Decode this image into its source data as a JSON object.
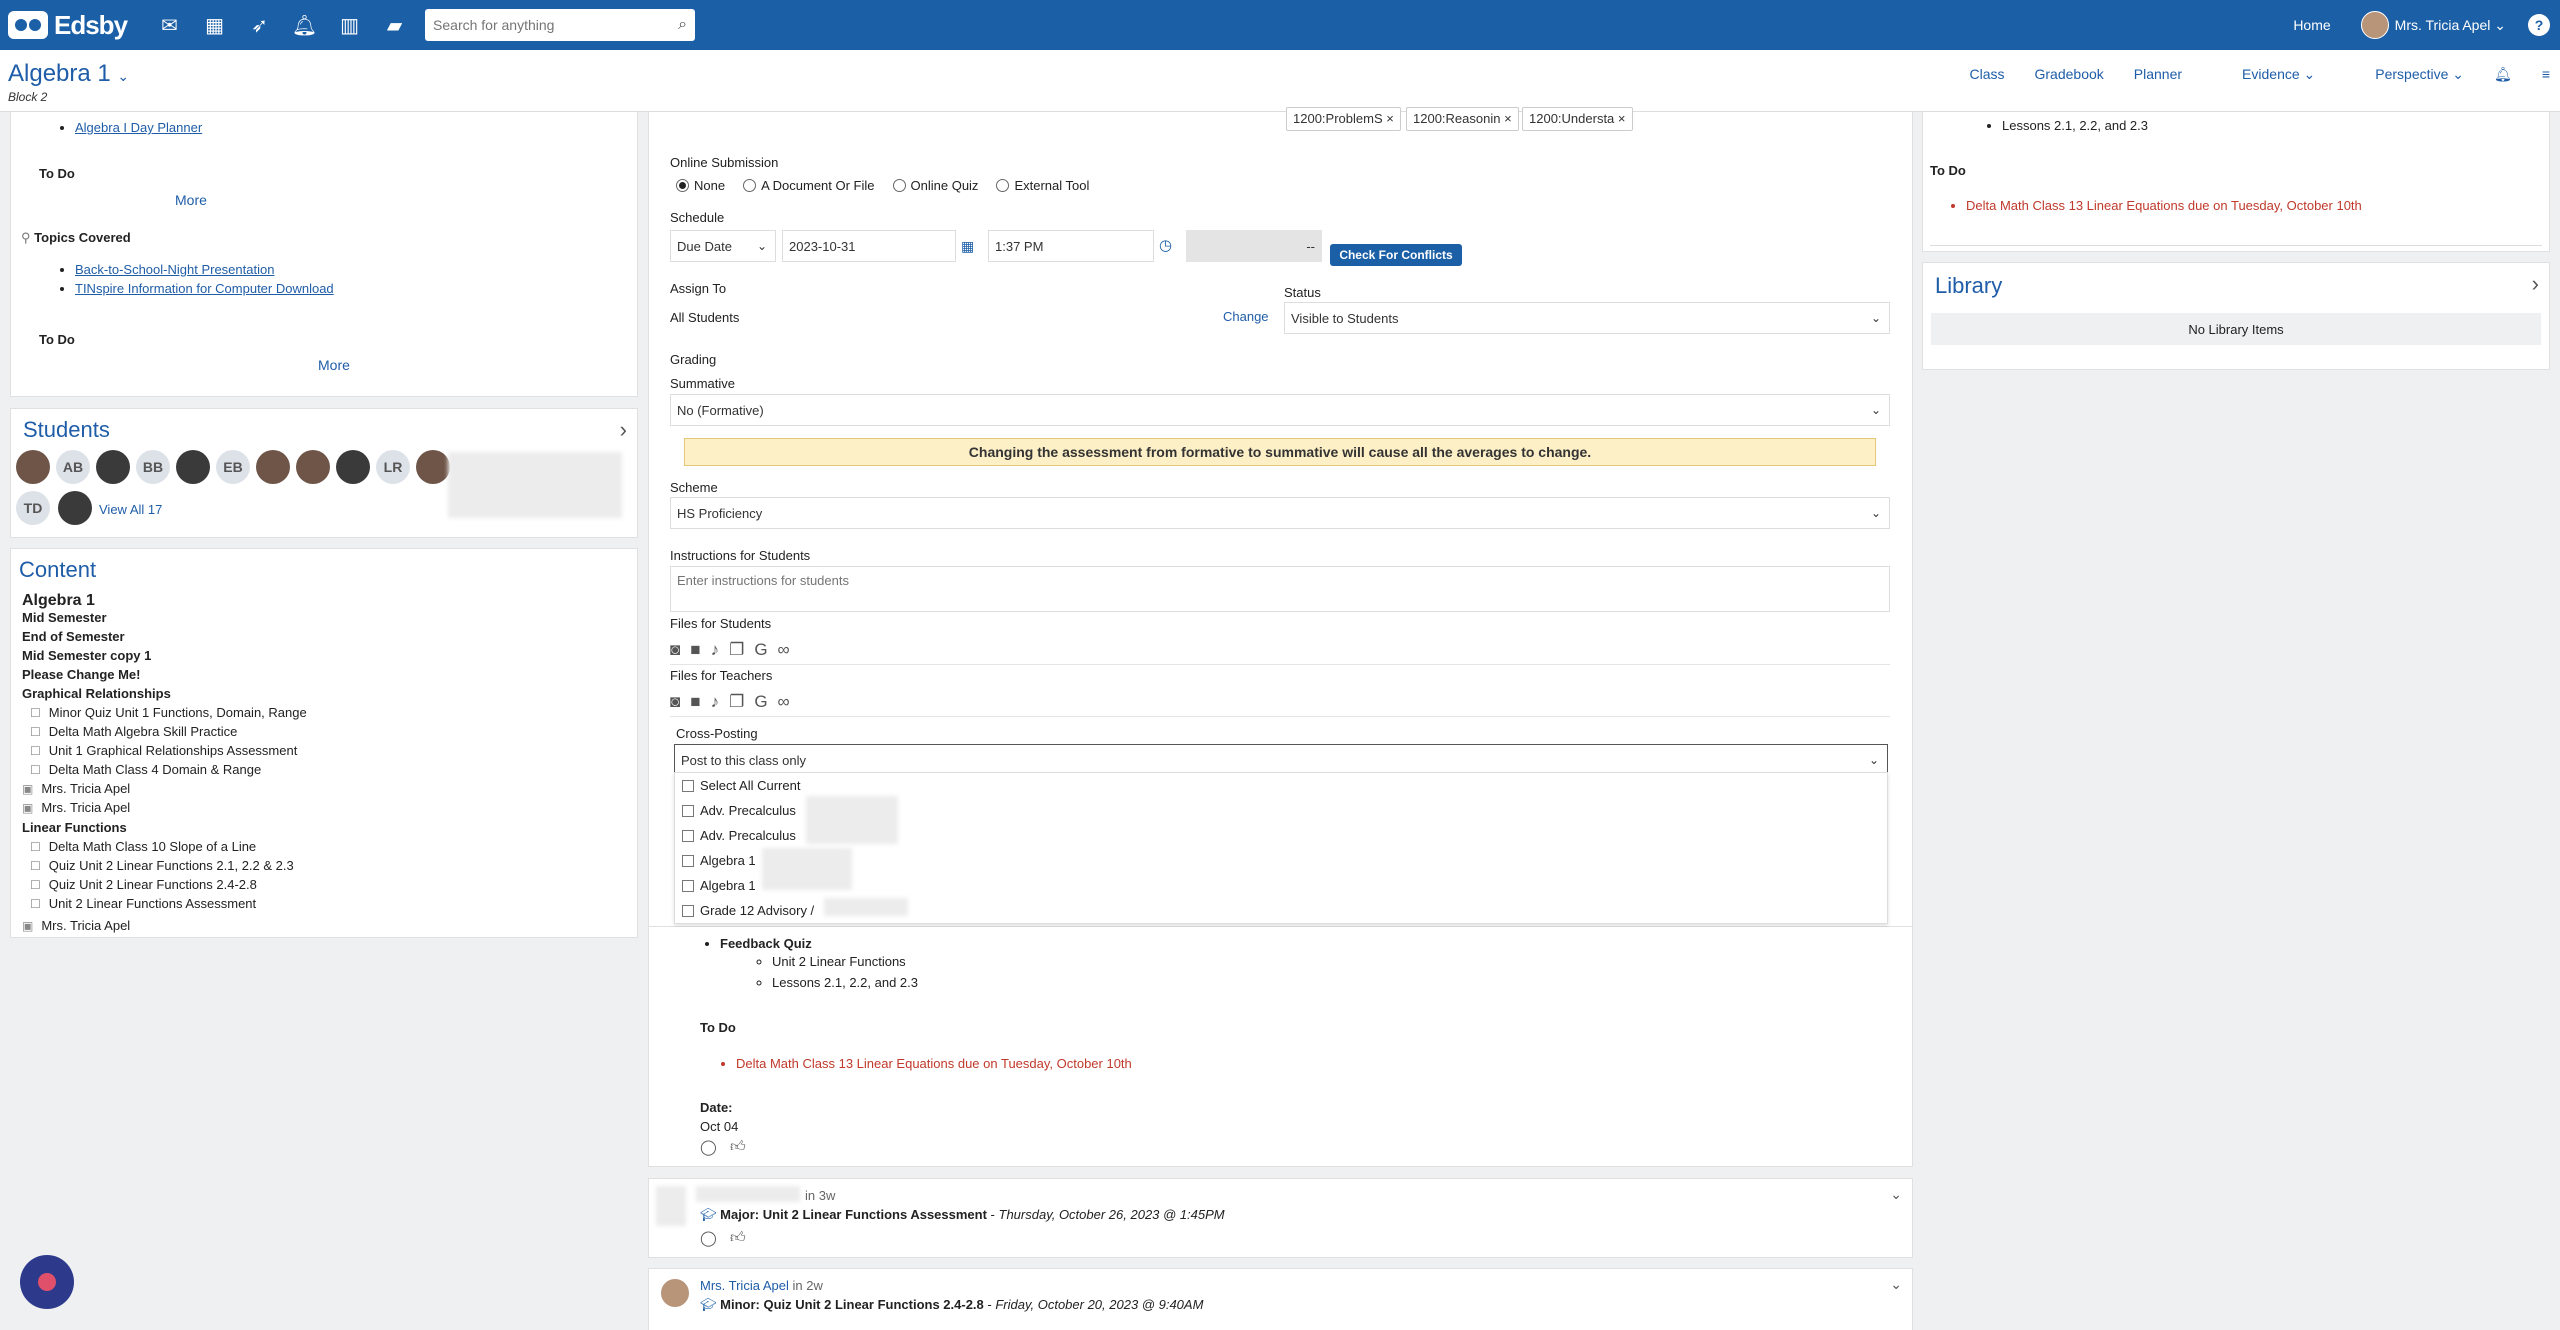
{
  "topbar": {
    "logo": "Edsby",
    "search_placeholder": "Search for anything",
    "home": "Home",
    "user": "Mrs. Tricia Apel",
    "help": "?"
  },
  "subbar": {
    "class_title": "Algebra 1",
    "block": "Block 2",
    "nav": [
      "Class",
      "Gradebook",
      "Planner",
      "Evidence",
      "Perspective"
    ]
  },
  "left": {
    "top_link": "Algebra I Day Planner",
    "todo1": "To Do",
    "more1": "More",
    "topics_title": "Topics Covered",
    "topics": [
      "Back-to-School-Night Presentation",
      "TINspire Information for Computer Download"
    ],
    "todo2": "To Do",
    "more2": "More"
  },
  "students": {
    "title": "Students",
    "initials": [
      "AB",
      "BB",
      "EB",
      "LR",
      "TD"
    ],
    "view_all": "View All 17"
  },
  "content": {
    "title": "Content",
    "items": [
      {
        "text": "Algebra 1",
        "bold": true,
        "big": true
      },
      {
        "text": "Mid Semester",
        "bold": true
      },
      {
        "text": "End of Semester",
        "bold": true
      },
      {
        "text": "Mid Semester copy 1",
        "bold": true
      },
      {
        "text": "Please Change Me!",
        "bold": true
      },
      {
        "text": "Graphical Relationships",
        "bold": true
      },
      {
        "text": "Minor Quiz Unit 1 Functions, Domain, Range",
        "indent": 2
      },
      {
        "text": "Delta Math Algebra Skill Practice",
        "indent": 2
      },
      {
        "text": "Unit 1 Graphical Relationships Assessment",
        "indent": 2
      },
      {
        "text": "Delta Math Class 4 Domain & Range",
        "indent": 2
      },
      {
        "text": "Mrs. Tricia Apel",
        "indent": 1
      },
      {
        "text": "Mrs. Tricia Apel",
        "indent": 1
      },
      {
        "text": "Linear Functions",
        "bold": true
      },
      {
        "text": "Delta Math Class 10 Slope of a Line",
        "indent": 2
      },
      {
        "text": "Quiz Unit 2 Linear Functions 2.1, 2.2 & 2.3",
        "indent": 2
      },
      {
        "text": "Quiz Unit 2 Linear Functions 2.4-2.8",
        "indent": 2
      },
      {
        "text": "Unit 2 Linear Functions Assessment",
        "indent": 2
      },
      {
        "text": "Mrs. Tricia Apel",
        "indent": 1
      }
    ]
  },
  "form": {
    "chips": [
      "1200:ProblemS",
      "1200:Reasonin",
      "1200:Understa"
    ],
    "online_submission_label": "Online Submission",
    "submission_options": [
      "None",
      "A Document Or File",
      "Online Quiz",
      "External Tool"
    ],
    "schedule_label": "Schedule",
    "due_type": "Due Date",
    "due_date": "2023-10-31",
    "due_time": "1:37 PM",
    "dash": "--",
    "check_conflicts": "Check For Conflicts",
    "assign_to_label": "Assign To",
    "assign_to_value": "All Students",
    "change": "Change",
    "status_label": "Status",
    "status_value": "Visible to Students",
    "grading_label": "Grading",
    "summative_label": "Summative",
    "summative_value": "No (Formative)",
    "warning": "Changing the assessment from formative to summative will cause all the averages to change.",
    "scheme_label": "Scheme",
    "scheme_value": "HS Proficiency",
    "instructions_label": "Instructions for Students",
    "instructions_placeholder": "Enter instructions for students",
    "files_students_label": "Files for Students",
    "files_teachers_label": "Files for Teachers",
    "crosspost_label": "Cross-Posting",
    "crosspost_value": "Post to this class only",
    "crosspost_options": [
      "Select All Current",
      "Adv. Precalculus",
      "Adv. Precalculus",
      "Algebra 1",
      "Algebra 1",
      "Grade 12 Advisory /"
    ]
  },
  "feed": {
    "feedback_quiz": "Feedback Quiz",
    "unit2": "Unit 2 Linear Functions",
    "lessons": "Lessons 2.1, 2.2, and 2.3",
    "todo": "To Do",
    "todo_item": "Delta Math Class 13 Linear Equations due on Tuesday, October 10th",
    "date_label": "Date:",
    "date_value": "Oct 04",
    "post2_time": "in 3w",
    "post2_title": "Major: Unit 2 Linear Functions Assessment",
    "post2_date": "Thursday, October 26, 2023 @ 1:45PM",
    "post3_author": "Mrs. Tricia Apel",
    "post3_time": "in 2w",
    "post3_title": "Minor: Quiz Unit 2 Linear Functions 2.4-2.8",
    "post3_date": "Friday, October 20, 2023 @ 9:40AM"
  },
  "right": {
    "lessons": "Lessons 2.1, 2.2, and 2.3",
    "todo": "To Do",
    "todo_item": "Delta Math Class 13 Linear Equations due on Tuesday, October 10th",
    "library_title": "Library",
    "library_empty": "No Library Items"
  }
}
